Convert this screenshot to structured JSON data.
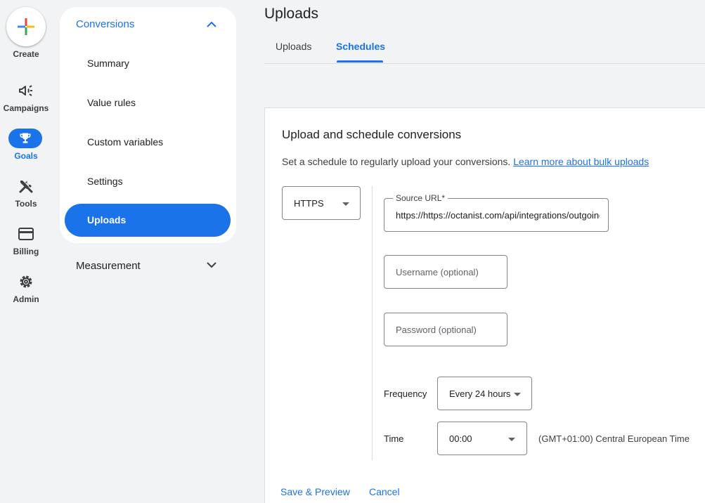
{
  "rail": {
    "create_label": "Create",
    "items": [
      {
        "label": "Campaigns",
        "icon": "megaphone-icon"
      },
      {
        "label": "Goals",
        "icon": "trophy-icon",
        "active": true
      },
      {
        "label": "Tools",
        "icon": "tools-icon"
      },
      {
        "label": "Billing",
        "icon": "credit-card-icon"
      },
      {
        "label": "Admin",
        "icon": "gear-icon"
      }
    ]
  },
  "nav": {
    "section_title": "Conversions",
    "items": [
      "Summary",
      "Value rules",
      "Custom variables",
      "Settings",
      "Uploads"
    ],
    "active_item": "Uploads",
    "measurement_label": "Measurement"
  },
  "header": {
    "title": "Uploads",
    "tabs": [
      {
        "label": "Uploads",
        "active": false
      },
      {
        "label": "Schedules",
        "active": true
      }
    ]
  },
  "card": {
    "title": "Upload and schedule conversions",
    "description": "Set a schedule to regularly upload your conversions.",
    "learn_more": "Learn more about bulk uploads",
    "protocol": "HTTPS",
    "source_url_label": "Source URL*",
    "source_url_value": "https://https://octanist.com/api/integrations/outgoing",
    "username_placeholder": "Username (optional)",
    "password_placeholder": "Password (optional)",
    "frequency_label": "Frequency",
    "frequency_value": "Every 24 hours",
    "time_label": "Time",
    "time_value": "00:00",
    "timezone": "(GMT+01:00) Central European Time",
    "save_label": "Save & Preview",
    "cancel_label": "Cancel"
  },
  "colors": {
    "accent": "#1a73e8",
    "background": "#f1f3f4",
    "text": "#202124"
  }
}
